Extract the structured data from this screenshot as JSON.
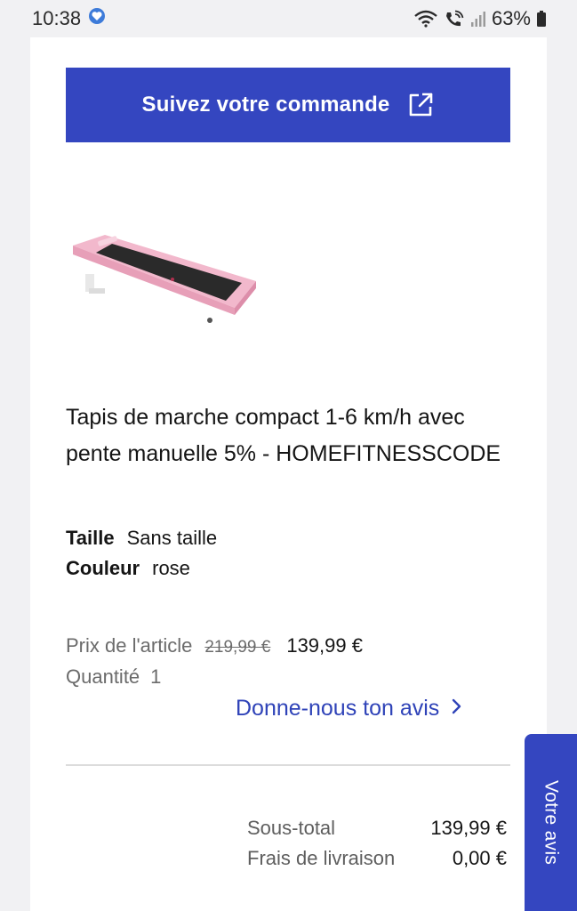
{
  "status_bar": {
    "time": "10:38",
    "battery": "63%"
  },
  "order": {
    "track_button_label": "Suivez votre commande",
    "product": {
      "title": "Tapis de marche compact 1-6 km/h avec pente manuelle 5% - HOMEFITNESSCODE",
      "attributes": [
        {
          "label": "Taille",
          "value": "Sans taille"
        },
        {
          "label": "Couleur",
          "value": "rose"
        }
      ],
      "price_label": "Prix de l'article",
      "old_price": "219,99 €",
      "price": "139,99 €",
      "quantity_label": "Quantité",
      "quantity": "1"
    },
    "review_link": "Donne-nous ton avis",
    "summary": {
      "subtotal_label": "Sous-total",
      "subtotal_value": "139,99 €",
      "shipping_label": "Frais de livraison",
      "shipping_value": "0,00 €"
    }
  },
  "feedback_tab_label": "Votre avis",
  "colors": {
    "brand_blue": "#3446c0",
    "link_blue": "#2f43b8",
    "product_pink": "#f2b8cc"
  },
  "icons": [
    "heart-badge-icon",
    "wifi-icon",
    "wifi-call-icon",
    "signal-icon",
    "battery-icon",
    "external-link-icon",
    "chevron-right-icon"
  ]
}
